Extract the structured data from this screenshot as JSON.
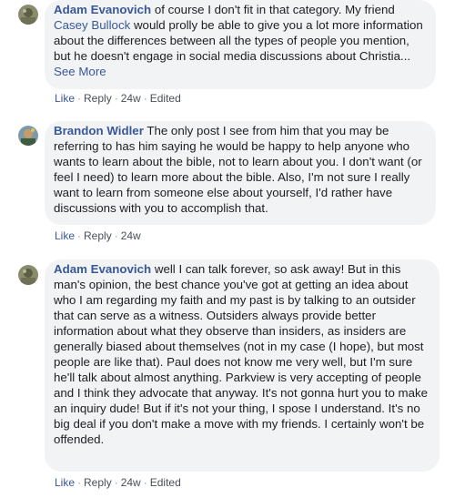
{
  "comments": [
    {
      "author": "Adam Evanovich",
      "text_before_mention": " of course I don't fit in that category. My friend ",
      "mention": "Casey Bullock",
      "text_after_mention": " would prolly be able to give you a lot more information about the differences between all the types of people you mention, but he doesn't engage in social media discussions about Christia...",
      "see_more": "See More",
      "actions": {
        "like": "Like",
        "reply": "Reply",
        "time": "24w",
        "edited": "Edited"
      },
      "avatar_icon": "profile-photo-icon"
    },
    {
      "author": "Brandon Widler",
      "text": " The only post I see from him that you may be referring to has him saying he would be happy to help anyone who wants to learn about the bible, not to learn about you. I don't want (or feel I need) to learn more about the bible. Also, I'm not sure I really want to learn from someone else about yourself, I'd rather have discussions with you to accomplish that.",
      "actions": {
        "like": "Like",
        "reply": "Reply",
        "time": "24w"
      },
      "avatar_icon": "profile-photo-icon"
    },
    {
      "author": "Adam Evanovich",
      "text": " well I can talk forever, so ask away! But in this man's opinion, the best chance you've got at getting an idea about who I am regarding my faith and my past is by talking to an outsider that can serve as a witness. Outsiders always provide better information about what they observe than insiders, as insiders are generally biased about themselves (not in my case (I hope), but most people are like that). Paul does not know me very well, but I'm sure he'll talk about almost anything. Parkview is very accepting of people and I think they advocate that anyway. It's not gonna hurt you to make an inquiry dude! But if it's not your thing, I spose I understand. It's no big deal if you don't make a move with my friends. I certainly won't be offended.",
      "actions": {
        "like": "Like",
        "reply": "Reply",
        "time": "24w",
        "edited": "Edited"
      },
      "avatar_icon": "profile-photo-icon"
    }
  ],
  "colors": {
    "bubble": "#f2f3f5",
    "name": "#385898",
    "action": "#4b4f56",
    "meta": "#90949c"
  }
}
